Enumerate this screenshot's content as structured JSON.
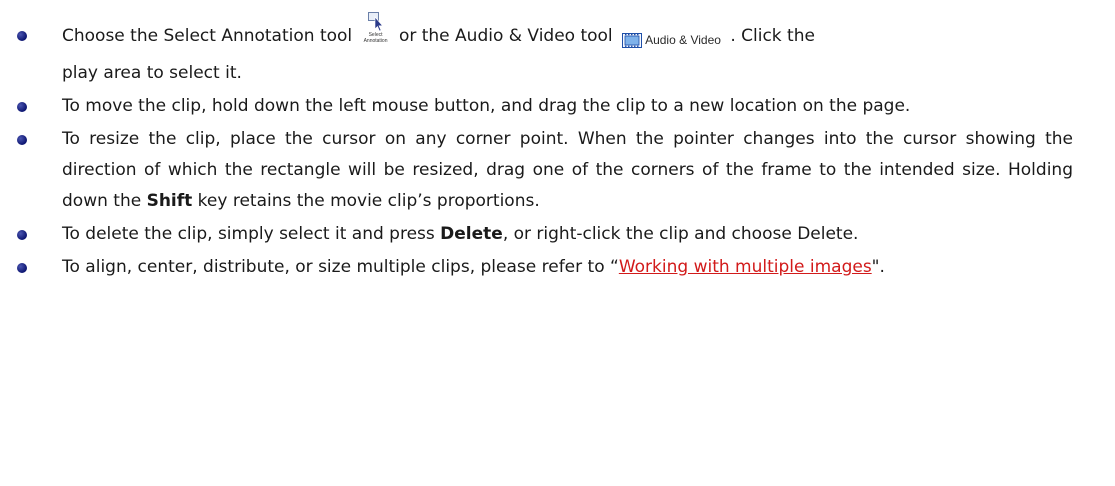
{
  "items": [
    {
      "p1": "Choose the Select Annotation tool",
      "select_icon_label_1": "Select",
      "select_icon_label_2": "Annotation",
      "p2": "or the Audio & Video tool",
      "av_icon_label": "Audio & Video",
      "p3": ". Click the",
      "p4": "play area to select it."
    },
    {
      "text": "To move the clip, hold down the left mouse button, and drag the clip to a new location on the page."
    },
    {
      "p1": "To resize the clip, place the cursor on any corner point. When the pointer changes into the cursor showing the direction of which the rectangle will be resized, drag one of the corners of the frame to the intended size. Holding down the ",
      "bold": "Shift",
      "p2": " key retains the movie clip’s proportions."
    },
    {
      "p1": "To delete the clip, simply select it and press ",
      "bold": "Delete",
      "p2": ", or right-click the clip and choose Delete."
    },
    {
      "p1": "To align, center, distribute, or size multiple clips, please refer to “",
      "link": "Working with multiple images",
      "p2": "\"."
    }
  ],
  "colors": {
    "bullet": "#0b1470",
    "link": "#d21a1a",
    "text": "#1a1a1a"
  },
  "icons": {
    "select_annotation": "cursor-arrow-icon",
    "audio_video": "film-strip-icon"
  }
}
